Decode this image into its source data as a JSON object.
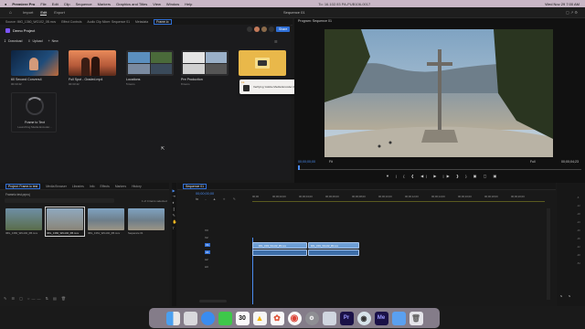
{
  "menubar": {
    "app_name": "Premiere Pro",
    "items": [
      "File",
      "Edit",
      "Clip",
      "Sequence",
      "Markers",
      "Graphics and Titles",
      "View",
      "Window",
      "Help"
    ],
    "center_title": "Sequence 01",
    "status_ip": "To: 16.102.93 PA-PUB106-0017",
    "clock": "Wed Nov 29  7:00 AM"
  },
  "header": {
    "tabs": [
      "Import",
      "Edit",
      "Export"
    ],
    "active_tab": "Edit",
    "center_title": "Sequence 01"
  },
  "source_tabs": [
    "Source: IMG_1360_WG102_0B.mov",
    "Effect Controls",
    "Audio Clip Mixer: Sequence 01",
    "Metadata",
    "Frame.io"
  ],
  "frameio": {
    "project_name": "Demo Project",
    "toolbar": {
      "download": "Download",
      "upload": "Upload",
      "new": "New",
      "share": "Share"
    },
    "cards": [
      {
        "title": "60 Second Convers4",
        "meta": "00:33:42",
        "thumb": "person"
      },
      {
        "title": "Full Spot - Graded.mp4",
        "meta": "00:33:42",
        "thumb": "couple"
      },
      {
        "title": "Locations",
        "meta": "5 items",
        "thumb": "locations"
      },
      {
        "title": "Pre Production",
        "meta": "8 items",
        "thumb": "preprod"
      },
      {
        "title": "",
        "meta": "",
        "thumb": "folder"
      }
    ],
    "toast": "Verifying 'Adobe Media Encoder 2023'...",
    "frame_to_text": {
      "title": "Frame to Text",
      "sub": "Launching Media Encoder..."
    }
  },
  "program": {
    "title": "Program: Sequence 01",
    "timecode_left": "00;00;00;00",
    "fit": "Fit",
    "quality": "Full",
    "timecode_right": "00;00;04;23"
  },
  "project": {
    "tabs": [
      "Project: Frame.io test",
      "Media Browser",
      "Libraries",
      "Info",
      "Effects",
      "Markers",
      "History"
    ],
    "bin": "Frameio test.prproj",
    "selected_count": "1 of 4 items selected",
    "items": [
      {
        "name": "IMG_1360_WG102_0B.mov",
        "dur": "4:23"
      },
      {
        "name": "IMG_1360_WG102_0B.mov",
        "dur": "4:23"
      },
      {
        "name": "IMG_1361_WG102_0B.mov",
        "dur": "4:23"
      },
      {
        "name": "Sequence 01",
        "dur": "4:23"
      }
    ]
  },
  "timeline": {
    "title": "Sequence 01",
    "timecode": "00;00;00;00",
    "ruler": [
      "00;00",
      "00;00;02;00",
      "00;00;04;00",
      "00;00;06;00",
      "00;00;08;00",
      "00;00;10;00",
      "00;00;12;00",
      "00;00;14;00",
      "00;00;16;00",
      "00;00;18;00",
      "00;00;20;00"
    ],
    "tracks": [
      "V3",
      "V2",
      "V1",
      "A1",
      "A2",
      "A3"
    ],
    "clip_names": [
      "IMG_1360_WG102_0B.mov",
      "IMG_1361_WG102_0B.mov"
    ]
  },
  "meters": {
    "labels": [
      "-6",
      "-12",
      "-18",
      "-24",
      "-30",
      "-36",
      "-42",
      "-48",
      "-54"
    ],
    "s1": "S",
    "s2": "S"
  },
  "dock": [
    "Finder",
    "Launchpad",
    "Safari",
    "Messages",
    "Calendar",
    "Drive",
    "Photos",
    "Chrome",
    "Settings",
    "Preview",
    "Premiere Pro",
    "Media Encoder",
    "Media Encoder",
    "Files",
    "Trash"
  ],
  "colors": {
    "accent": "#2f6fd6",
    "clip_video": "#6e9fd6",
    "clip_audio": "#3e6ea8",
    "playhead": "#4b8cf0",
    "menubar": "#c9b7c6"
  }
}
